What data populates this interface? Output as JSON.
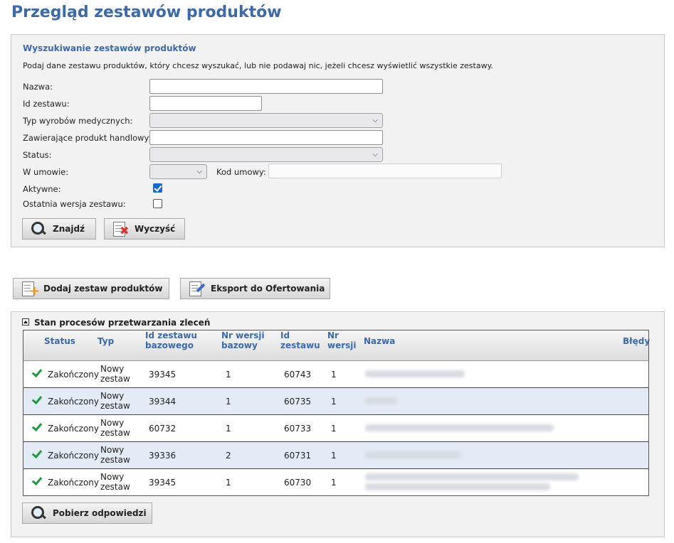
{
  "page_title": "Przegląd zestawów produktów",
  "search": {
    "title": "Wyszukiwanie zestawów produktów",
    "description": "Podaj dane zestawu produktów, który chcesz wyszukać, lub nie podawaj nic, jeżeli chcesz wyświetlić wszystkie zestawy.",
    "labels": {
      "nazwa": "Nazwa:",
      "id_zestawu": "Id zestawu:",
      "typ_wyrobow": "Typ wyrobów medycznych:",
      "zawierajace": "Zawierające produkt handlowy:",
      "status": "Status:",
      "w_umowie": "W umowie:",
      "kod_umowy": "Kod umowy:",
      "aktywne": "Aktywne:",
      "ostatnia_wersja": "Ostatnia wersja zestawu:"
    },
    "values": {
      "nazwa": "",
      "id_zestawu": "",
      "typ_wyrobow": "",
      "zawierajace": "",
      "status": "",
      "w_umowie": "",
      "kod_umowy": "",
      "aktywne": true,
      "ostatnia_wersja": false
    },
    "buttons": {
      "find": "Znajdź",
      "clear": "Wyczyść"
    }
  },
  "actions": {
    "add": "Dodaj zestaw produktów",
    "export": "Eksport do Ofertowania"
  },
  "processes": {
    "title": "Stan procesów przetwarzania zleceń",
    "headers": {
      "status": "Status",
      "typ": "Typ",
      "id_bazowy_1": "Id zestawu",
      "id_bazowy_2": "bazowego",
      "nr_wersji_baz_1": "Nr wersji",
      "nr_wersji_baz_2": "bazowy",
      "id_zestawu_1": "Id",
      "id_zestawu_2": "zestawu",
      "nr_wersji_1": "Nr",
      "nr_wersji_2": "wersji",
      "nazwa": "Nazwa",
      "bledy": "Błędy"
    },
    "rows": [
      {
        "status": "Zakończony",
        "typ_1": "Nowy",
        "typ_2": "zestaw",
        "id_bazowy": "39345",
        "nr_wersji_bazowy": "1",
        "id_zestawu": "60743",
        "nr_wersji": "1"
      },
      {
        "status": "Zakończony",
        "typ_1": "Nowy",
        "typ_2": "zestaw",
        "id_bazowy": "39344",
        "nr_wersji_bazowy": "1",
        "id_zestawu": "60735",
        "nr_wersji": "1"
      },
      {
        "status": "Zakończony",
        "typ_1": "Nowy",
        "typ_2": "zestaw",
        "id_bazowy": "60732",
        "nr_wersji_bazowy": "1",
        "id_zestawu": "60733",
        "nr_wersji": "1"
      },
      {
        "status": "Zakończony",
        "typ_1": "Nowy",
        "typ_2": "zestaw",
        "id_bazowy": "39336",
        "nr_wersji_bazowy": "2",
        "id_zestawu": "60731",
        "nr_wersji": "1"
      },
      {
        "status": "Zakończony",
        "typ_1": "Nowy",
        "typ_2": "zestaw",
        "id_bazowy": "39345",
        "nr_wersji_bazowy": "1",
        "id_zestawu": "60730",
        "nr_wersji": "1"
      }
    ],
    "fetch_button": "Pobierz odpowiedzi"
  }
}
